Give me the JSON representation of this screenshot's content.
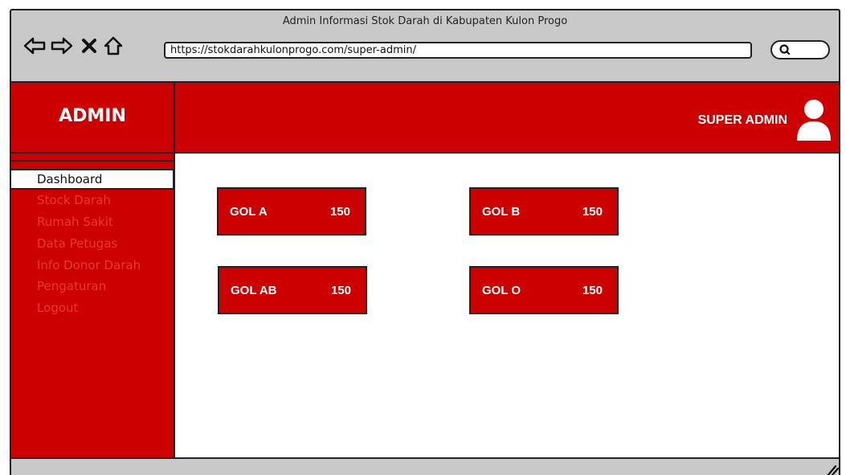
{
  "browser": {
    "title": "Admin Informasi Stok Darah di Kabupaten Kulon Progo",
    "url": "https://stokdarahkulonprogo.com/super-admin/",
    "nav_icons": [
      "back-arrow-icon",
      "forward-arrow-icon",
      "close-icon",
      "home-icon"
    ],
    "search_icon": "search-icon"
  },
  "header": {
    "brand": "ADMIN",
    "user_label": "SUPER ADMIN",
    "user_icon": "user-avatar-icon"
  },
  "sidebar": {
    "items": [
      {
        "label": "Dashboard",
        "active": true
      },
      {
        "label": "Stock Darah",
        "active": false
      },
      {
        "label": "Rumah Sakit",
        "active": false
      },
      {
        "label": "Data Petugas",
        "active": false
      },
      {
        "label": "Info Donor Darah",
        "active": false
      },
      {
        "label": "Pengaturan",
        "active": false
      },
      {
        "label": "Logout",
        "active": false
      }
    ]
  },
  "cards": [
    {
      "label": "GOL A",
      "value": "150"
    },
    {
      "label": "GOL B",
      "value": "150"
    },
    {
      "label": "GOL AB",
      "value": "150"
    },
    {
      "label": "GOL O",
      "value": "150"
    }
  ],
  "colors": {
    "accent": "#cc0000",
    "chrome": "#c9c9c9",
    "inactive_menu_text": "#e63a2e"
  }
}
